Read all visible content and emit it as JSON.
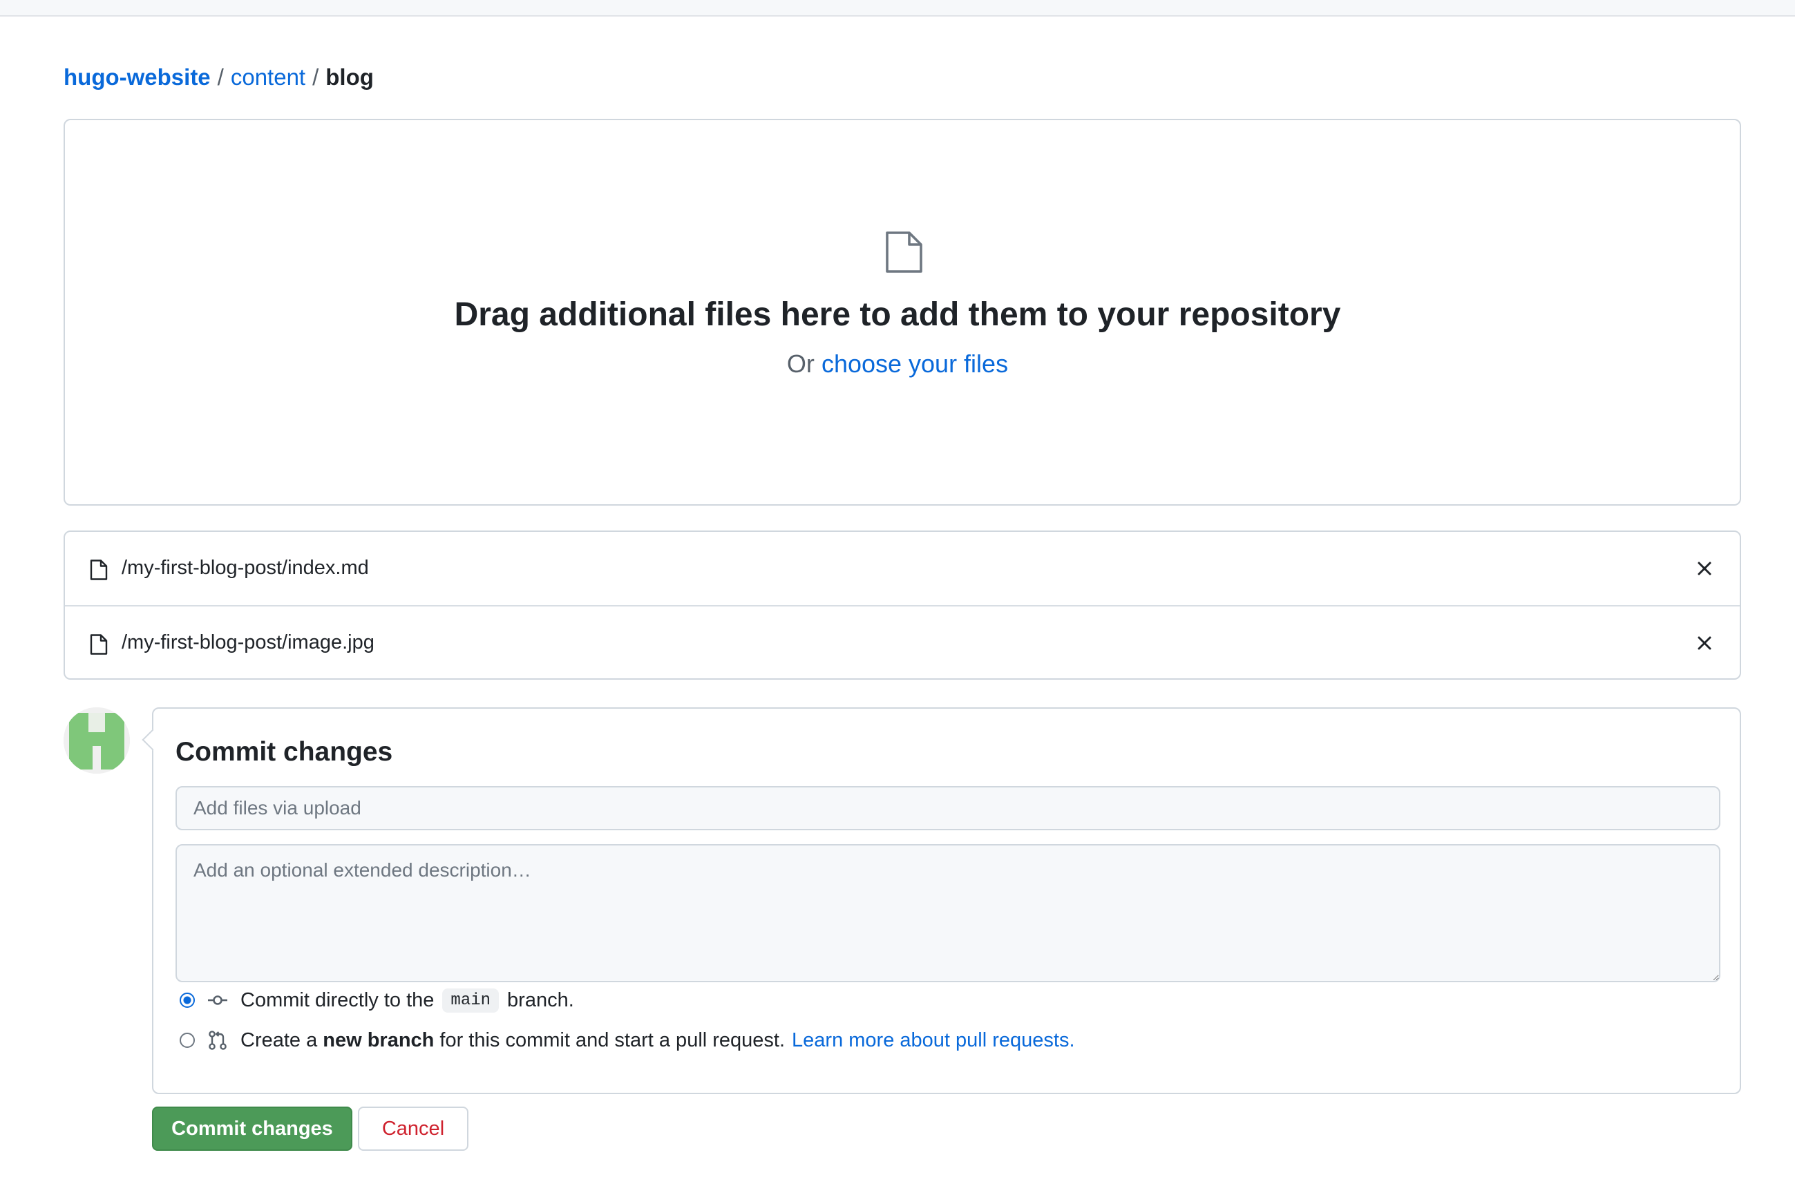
{
  "breadcrumb": {
    "repo": "hugo-website",
    "folder": "content",
    "separator": "/",
    "current": "blog"
  },
  "dropzone": {
    "icon": "file-icon",
    "title": "Drag additional files here to add them to your repository",
    "or_text": "Or",
    "choose_link": "choose your files"
  },
  "files": [
    {
      "name": "/my-first-blog-post/index.md",
      "icon": "file-icon",
      "remove_icon": "x-icon"
    },
    {
      "name": "/my-first-blog-post/image.jpg",
      "icon": "file-icon",
      "remove_icon": "x-icon"
    }
  ],
  "commit": {
    "title": "Commit changes",
    "summary_placeholder": "Add files via upload",
    "description_placeholder": "Add an optional extended description…",
    "option_direct": {
      "selected": true,
      "prefix": "Commit directly to the",
      "branch": "main",
      "suffix": "branch."
    },
    "option_new_branch": {
      "selected": false,
      "prefix": "Create a",
      "bold": "new branch",
      "suffix": "for this commit and start a pull request.",
      "link": "Learn more about pull requests."
    },
    "commit_button": "Commit changes",
    "cancel_button": "Cancel"
  },
  "colors": {
    "link": "#0969da",
    "primary_button": "#4c9a58",
    "danger_text": "#cf222e",
    "border": "#d0d7de",
    "avatar": "#7fc77a"
  }
}
